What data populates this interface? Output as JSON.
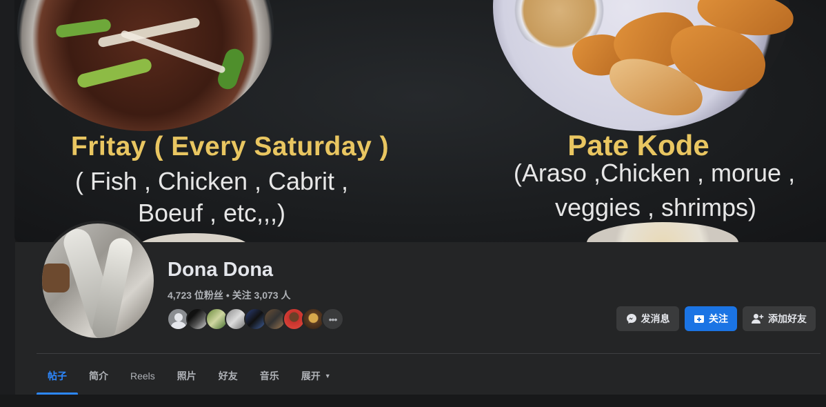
{
  "cover": {
    "fritay_title": "Fritay ( Every Saturday )",
    "fritay_line1": "( Fish , Chicken , Cabrit ,",
    "fritay_line2": "Boeuf  , etc,,,)",
    "pate_title": "Pate Kode",
    "pate_line1": "(Araso ,Chicken , morue  ,",
    "pate_line2": "veggies , shrimps)"
  },
  "profile": {
    "name": "Dona Dona",
    "followers": "4,723 位粉丝",
    "separator": " • ",
    "following": "关注 3,073 人"
  },
  "friends_avatars": [
    "default-avatar",
    "friend-2",
    "friend-3",
    "friend-4",
    "friend-5",
    "friend-6",
    "friend-7",
    "friend-8",
    "more"
  ],
  "actions": {
    "message": "发消息",
    "follow": "关注",
    "add_friend": "添加好友"
  },
  "tabs": [
    {
      "label": "帖子",
      "active": true
    },
    {
      "label": "简介"
    },
    {
      "label": "Reels"
    },
    {
      "label": "照片"
    },
    {
      "label": "好友"
    },
    {
      "label": "音乐"
    },
    {
      "label": "展开"
    }
  ],
  "colors": {
    "accent": "#2d88ff",
    "follow_button": "#1b74e4",
    "surface": "#242526",
    "background": "#18191a"
  }
}
